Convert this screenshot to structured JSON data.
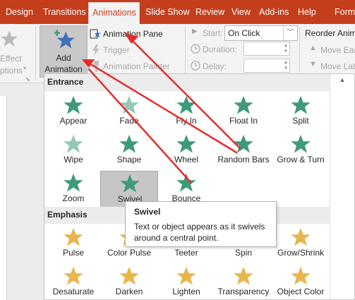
{
  "tabs": [
    {
      "label": "Design",
      "active": false
    },
    {
      "label": "Transitions",
      "active": false
    },
    {
      "label": "Animations",
      "active": true
    },
    {
      "label": "Slide Show",
      "active": false
    },
    {
      "label": "Review",
      "active": false
    },
    {
      "label": "View",
      "active": false
    },
    {
      "label": "Add-ins",
      "active": false
    },
    {
      "label": "Help",
      "active": false
    },
    {
      "label": "Form",
      "active": false
    }
  ],
  "ribbon": {
    "effect_options_line1": "Effect",
    "effect_options_line2": "ptions",
    "add_animation_line1": "Add",
    "add_animation_line2": "Animation",
    "animation_pane": "Animation Pane",
    "trigger": "Trigger",
    "animation_painter": "Animation Painter",
    "start_label": "Start:",
    "start_value": "On Click",
    "duration_label": "Duration:",
    "delay_label": "Delay:",
    "reorder_title": "Reorder Anim",
    "move_earlier": "Move Ear",
    "move_later": "Move Lat"
  },
  "gallery": {
    "entrance_header": "Entrance",
    "emphasis_header": "Emphasis",
    "entrance": [
      {
        "label": "Appear",
        "icon": "appear-star-icon"
      },
      {
        "label": "Fade",
        "icon": "fade-star-icon"
      },
      {
        "label": "Fly In",
        "icon": "fly-in-star-icon"
      },
      {
        "label": "Float In",
        "icon": "float-in-star-icon"
      },
      {
        "label": "Split",
        "icon": "split-star-icon"
      },
      {
        "label": "Wipe",
        "icon": "wipe-star-icon"
      },
      {
        "label": "Shape",
        "icon": "shape-star-icon"
      },
      {
        "label": "Wheel",
        "icon": "wheel-star-icon"
      },
      {
        "label": "Random Bars",
        "icon": "random-bars-star-icon"
      },
      {
        "label": "Grow & Turn",
        "icon": "grow-turn-star-icon"
      },
      {
        "label": "Zoom",
        "icon": "zoom-star-icon"
      },
      {
        "label": "Swivel",
        "icon": "swivel-star-icon",
        "selected": true
      },
      {
        "label": "Bounce",
        "icon": "bounce-star-icon"
      }
    ],
    "emphasis": [
      {
        "label": "Pulse",
        "icon": "pulse-star-icon"
      },
      {
        "label": "Color Pulse",
        "icon": "color-pulse-star-icon"
      },
      {
        "label": "Teeter",
        "icon": "teeter-star-icon"
      },
      {
        "label": "Spin",
        "icon": "spin-star-icon"
      },
      {
        "label": "Grow/Shrink",
        "icon": "grow-shrink-star-icon"
      },
      {
        "label": "Desaturate",
        "icon": "desaturate-star-icon"
      },
      {
        "label": "Darken",
        "icon": "darken-star-icon"
      },
      {
        "label": "Lighten",
        "icon": "lighten-star-icon"
      },
      {
        "label": "Transparency",
        "icon": "transparency-star-icon"
      },
      {
        "label": "Object Color",
        "icon": "object-color-star-icon"
      }
    ]
  },
  "tooltip": {
    "title": "Swivel",
    "body": "Text or object appears as it swivels around a central point."
  },
  "colors": {
    "brand": "#c43e1c",
    "entrance_green": "#3f9a7c",
    "emphasis_gold": "#e8b64c",
    "annotation_arrow": "#e52c2c"
  }
}
